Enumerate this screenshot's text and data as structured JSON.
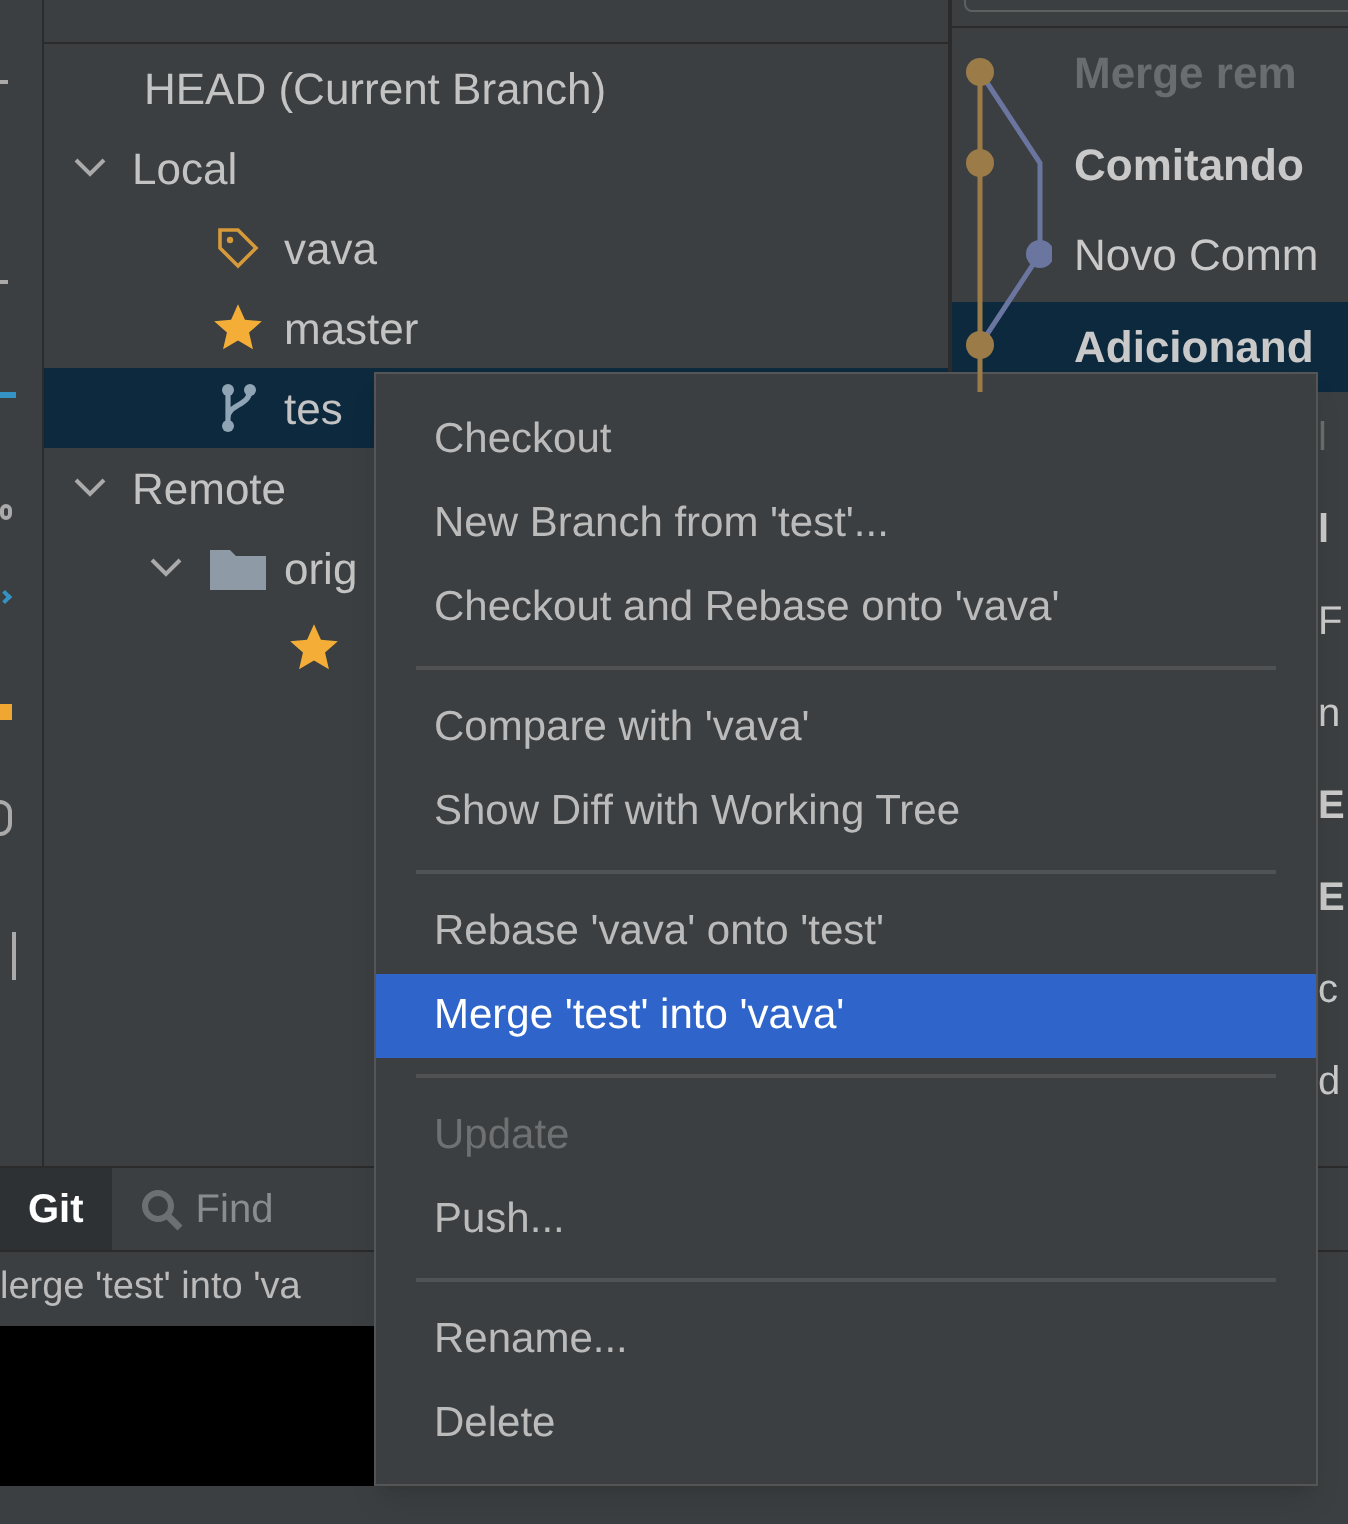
{
  "branches_tree": [
    {
      "label": "HEAD (Current Branch)",
      "kind": "head",
      "selected": false
    },
    {
      "label": "Local",
      "kind": "group",
      "expanded": true,
      "selected": false,
      "children": [
        {
          "label": "vava",
          "kind": "tag",
          "selected": false
        },
        {
          "label": "master",
          "kind": "favorite",
          "selected": false
        },
        {
          "label": "tes",
          "kind": "branch",
          "selected": true
        }
      ]
    },
    {
      "label": "Remote",
      "kind": "group",
      "expanded": true,
      "selected": false,
      "children": [
        {
          "label": "orig",
          "kind": "folder",
          "expanded": true,
          "selected": false,
          "children": [
            {
              "kind": "favorite",
              "selected": false
            }
          ]
        }
      ]
    }
  ],
  "commit_log": {
    "rows": [
      {
        "message": "Merge rem",
        "bold": true,
        "dim": true,
        "selected": false,
        "kind": "main"
      },
      {
        "message": "Comitando",
        "bold": true,
        "dim": false,
        "selected": false,
        "kind": "main"
      },
      {
        "message": "Novo Comm",
        "bold": false,
        "dim": false,
        "selected": false,
        "kind": "side"
      },
      {
        "message": "Adicionand",
        "bold": true,
        "dim": false,
        "selected": true,
        "kind": "main"
      }
    ],
    "hidden_rows": [
      {
        "message": "l",
        "bold": false,
        "dim": true
      },
      {
        "message": "l",
        "bold": true,
        "dim": false
      },
      {
        "message": "F",
        "bold": false,
        "dim": false
      },
      {
        "message": "n",
        "bold": false,
        "dim": false
      },
      {
        "message": "E",
        "bold": true,
        "dim": false
      },
      {
        "message": "E",
        "bold": true,
        "dim": false
      },
      {
        "message": "c",
        "bold": false,
        "dim": false
      },
      {
        "message": "d",
        "bold": false,
        "dim": false
      }
    ]
  },
  "tool_tabs": [
    {
      "label": "Git",
      "selected": true,
      "kind": "git"
    },
    {
      "label": "Find",
      "selected": false,
      "kind": "find"
    }
  ],
  "status_text": "lerge 'test' into 'va",
  "context_menu": [
    {
      "kind": "item",
      "label": "Checkout",
      "selected": false,
      "disabled": false
    },
    {
      "kind": "item",
      "label": "New Branch from 'test'...",
      "selected": false,
      "disabled": false
    },
    {
      "kind": "item",
      "label": "Checkout and Rebase onto 'vava'",
      "selected": false,
      "disabled": false
    },
    {
      "kind": "separator"
    },
    {
      "kind": "item",
      "label": "Compare with 'vava'",
      "selected": false,
      "disabled": false
    },
    {
      "kind": "item",
      "label": "Show Diff with Working Tree",
      "selected": false,
      "disabled": false
    },
    {
      "kind": "separator"
    },
    {
      "kind": "item",
      "label": "Rebase 'vava' onto 'test'",
      "selected": false,
      "disabled": false
    },
    {
      "kind": "item",
      "label": "Merge 'test' into 'vava'",
      "selected": true,
      "disabled": false
    },
    {
      "kind": "separator"
    },
    {
      "kind": "item",
      "label": "Update",
      "selected": false,
      "disabled": true
    },
    {
      "kind": "item",
      "label": "Push...",
      "selected": false,
      "disabled": false
    },
    {
      "kind": "separator"
    },
    {
      "kind": "item",
      "label": "Rename...",
      "selected": false,
      "disabled": false
    },
    {
      "kind": "item",
      "label": "Delete",
      "selected": false,
      "disabled": false
    }
  ]
}
